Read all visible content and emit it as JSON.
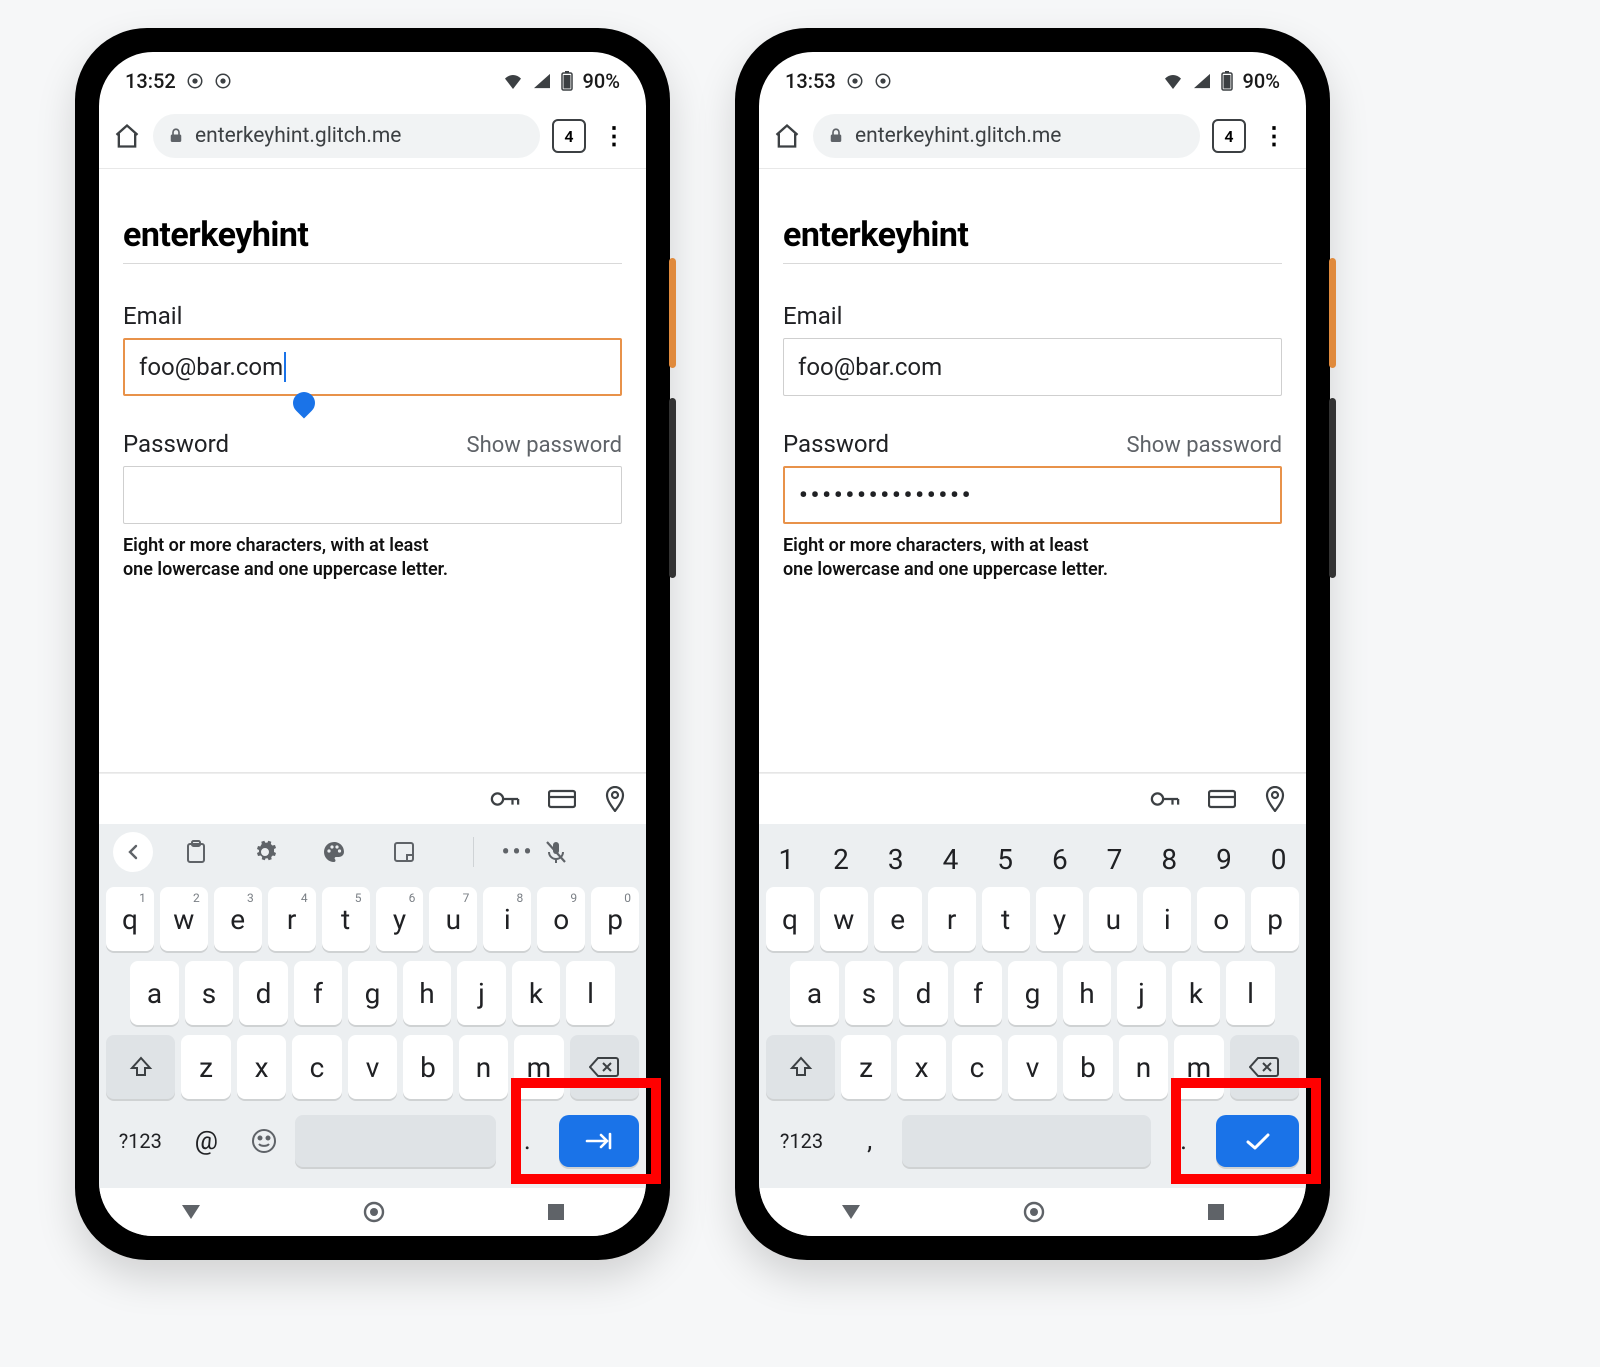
{
  "colors": {
    "accent_border": "#e8924a",
    "enter_key": "#1a73e8",
    "highlight": "#ff0000"
  },
  "left": {
    "status": {
      "time": "13:52",
      "battery": "90%"
    },
    "address_bar": {
      "url": "enterkeyhint.glitch.me",
      "tab_count": "4"
    },
    "page": {
      "heading": "enterkeyhint",
      "email_label": "Email",
      "email_value": "foo@bar.com",
      "password_label": "Password",
      "show_password": "Show password",
      "password_value": "",
      "hint_line1": "Eight or more characters, with at least",
      "hint_line2": "one lowercase and one uppercase letter.",
      "focused_field": "email"
    },
    "keyboard": {
      "has_toolbar": true,
      "num_superscripts": [
        "1",
        "2",
        "3",
        "4",
        "5",
        "6",
        "7",
        "8",
        "9",
        "0"
      ],
      "row1": [
        "q",
        "w",
        "e",
        "r",
        "t",
        "y",
        "u",
        "i",
        "o",
        "p"
      ],
      "row2": [
        "a",
        "s",
        "d",
        "f",
        "g",
        "h",
        "j",
        "k",
        "l"
      ],
      "row3": [
        "z",
        "x",
        "c",
        "v",
        "b",
        "n",
        "m"
      ],
      "sym_label": "?123",
      "extra_left": "@",
      "emoji": "☺",
      "period": ".",
      "enter_icon": "next"
    }
  },
  "right": {
    "status": {
      "time": "13:53",
      "battery": "90%"
    },
    "address_bar": {
      "url": "enterkeyhint.glitch.me",
      "tab_count": "4"
    },
    "page": {
      "heading": "enterkeyhint",
      "email_label": "Email",
      "email_value": "foo@bar.com",
      "password_label": "Password",
      "show_password": "Show password",
      "password_value": "•••••••••••••••",
      "hint_line1": "Eight or more characters, with at least",
      "hint_line2": "one lowercase and one uppercase letter.",
      "focused_field": "password"
    },
    "keyboard": {
      "has_toolbar": false,
      "numrow": [
        "1",
        "2",
        "3",
        "4",
        "5",
        "6",
        "7",
        "8",
        "9",
        "0"
      ],
      "row1": [
        "q",
        "w",
        "e",
        "r",
        "t",
        "y",
        "u",
        "i",
        "o",
        "p"
      ],
      "row2": [
        "a",
        "s",
        "d",
        "f",
        "g",
        "h",
        "j",
        "k",
        "l"
      ],
      "row3": [
        "z",
        "x",
        "c",
        "v",
        "b",
        "n",
        "m"
      ],
      "sym_label": "?123",
      "extra_left": ",",
      "period": ".",
      "enter_icon": "done"
    }
  }
}
